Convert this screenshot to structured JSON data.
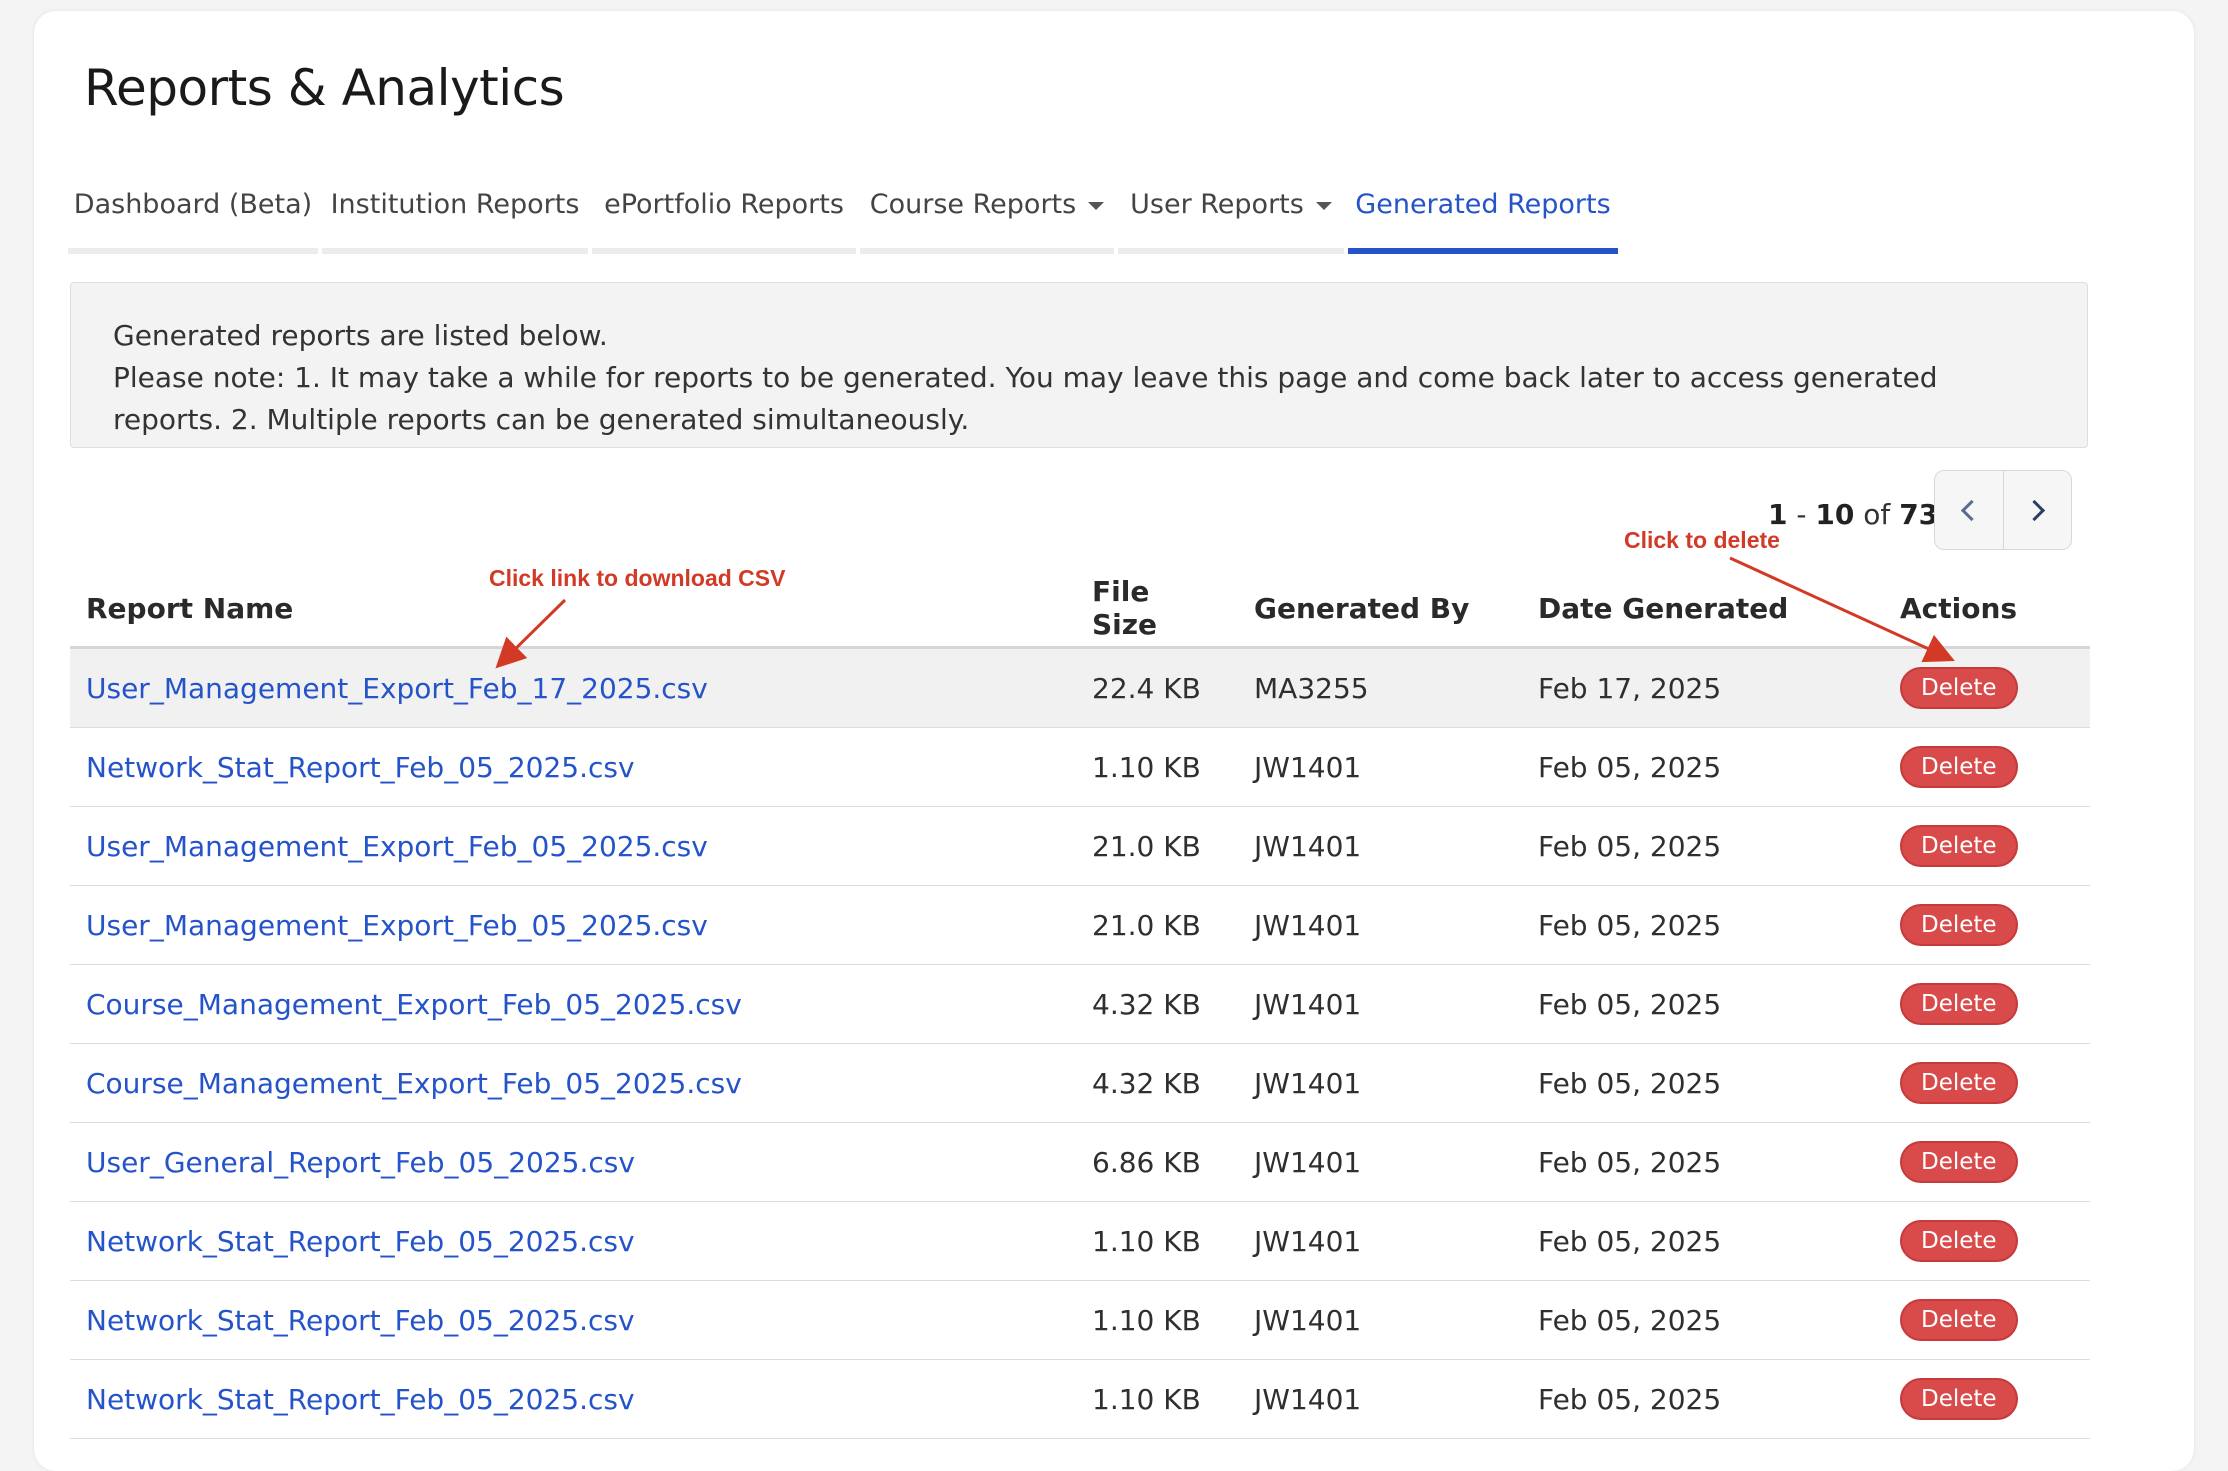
{
  "page": {
    "title": "Reports & Analytics"
  },
  "tabs": [
    {
      "label": "Dashboard (Beta)",
      "has_caret": false,
      "active": false
    },
    {
      "label": "Institution Reports",
      "has_caret": false,
      "active": false
    },
    {
      "label": "ePortfolio Reports",
      "has_caret": false,
      "active": false
    },
    {
      "label": "Course Reports",
      "has_caret": true,
      "active": false
    },
    {
      "label": "User Reports",
      "has_caret": true,
      "active": false
    },
    {
      "label": "Generated Reports",
      "has_caret": false,
      "active": true
    }
  ],
  "notice": {
    "line1": "Generated reports are listed below.",
    "line2": "Please note: 1. It may take a while for reports to be generated. You may leave this page and come back later to access generated reports. 2. Multiple reports can be generated simultaneously."
  },
  "pagination": {
    "range_start": "1",
    "separator": "-",
    "range_end": "10",
    "of_label": "of",
    "total": "73",
    "prev_icon": "chevron-left-icon",
    "next_icon": "chevron-right-icon"
  },
  "annotations": {
    "download": "Click link to download CSV",
    "delete": "Click to delete"
  },
  "table": {
    "headers": {
      "name": "Report Name",
      "size": "File Size",
      "by": "Generated By",
      "date": "Date Generated",
      "actions": "Actions"
    },
    "delete_label": "Delete",
    "rows": [
      {
        "name": "User_Management_Export_Feb_17_2025.csv",
        "size": "22.4 KB",
        "by": "MA3255",
        "date": "Feb 17, 2025"
      },
      {
        "name": "Network_Stat_Report_Feb_05_2025.csv",
        "size": "1.10 KB",
        "by": "JW1401",
        "date": "Feb 05, 2025"
      },
      {
        "name": "User_Management_Export_Feb_05_2025.csv",
        "size": "21.0 KB",
        "by": "JW1401",
        "date": "Feb 05, 2025"
      },
      {
        "name": "User_Management_Export_Feb_05_2025.csv",
        "size": "21.0 KB",
        "by": "JW1401",
        "date": "Feb 05, 2025"
      },
      {
        "name": "Course_Management_Export_Feb_05_2025.csv",
        "size": "4.32 KB",
        "by": "JW1401",
        "date": "Feb 05, 2025"
      },
      {
        "name": "Course_Management_Export_Feb_05_2025.csv",
        "size": "4.32 KB",
        "by": "JW1401",
        "date": "Feb 05, 2025"
      },
      {
        "name": "User_General_Report_Feb_05_2025.csv",
        "size": "6.86 KB",
        "by": "JW1401",
        "date": "Feb 05, 2025"
      },
      {
        "name": "Network_Stat_Report_Feb_05_2025.csv",
        "size": "1.10 KB",
        "by": "JW1401",
        "date": "Feb 05, 2025"
      },
      {
        "name": "Network_Stat_Report_Feb_05_2025.csv",
        "size": "1.10 KB",
        "by": "JW1401",
        "date": "Feb 05, 2025"
      },
      {
        "name": "Network_Stat_Report_Feb_05_2025.csv",
        "size": "1.10 KB",
        "by": "JW1401",
        "date": "Feb 05, 2025"
      }
    ]
  },
  "colors": {
    "accent": "#2553c9",
    "danger": "#d94a4a",
    "annotation": "#d23a26"
  }
}
